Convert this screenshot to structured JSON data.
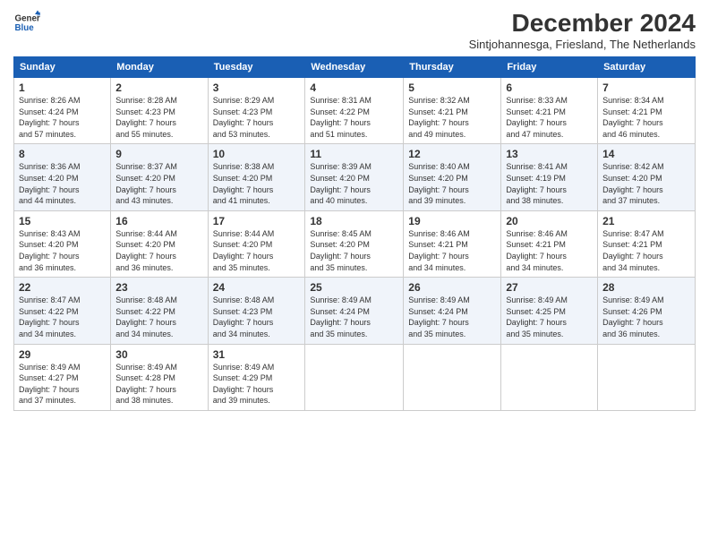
{
  "logo": {
    "line1": "General",
    "line2": "Blue"
  },
  "title": "December 2024",
  "subtitle": "Sintjohannesga, Friesland, The Netherlands",
  "days_of_week": [
    "Sunday",
    "Monday",
    "Tuesday",
    "Wednesday",
    "Thursday",
    "Friday",
    "Saturday"
  ],
  "weeks": [
    [
      {
        "day": "1",
        "sunrise": "8:26 AM",
        "sunset": "4:24 PM",
        "daylight": "7 hours and 57 minutes."
      },
      {
        "day": "2",
        "sunrise": "8:28 AM",
        "sunset": "4:23 PM",
        "daylight": "7 hours and 55 minutes."
      },
      {
        "day": "3",
        "sunrise": "8:29 AM",
        "sunset": "4:23 PM",
        "daylight": "7 hours and 53 minutes."
      },
      {
        "day": "4",
        "sunrise": "8:31 AM",
        "sunset": "4:22 PM",
        "daylight": "7 hours and 51 minutes."
      },
      {
        "day": "5",
        "sunrise": "8:32 AM",
        "sunset": "4:21 PM",
        "daylight": "7 hours and 49 minutes."
      },
      {
        "day": "6",
        "sunrise": "8:33 AM",
        "sunset": "4:21 PM",
        "daylight": "7 hours and 47 minutes."
      },
      {
        "day": "7",
        "sunrise": "8:34 AM",
        "sunset": "4:21 PM",
        "daylight": "7 hours and 46 minutes."
      }
    ],
    [
      {
        "day": "8",
        "sunrise": "8:36 AM",
        "sunset": "4:20 PM",
        "daylight": "7 hours and 44 minutes."
      },
      {
        "day": "9",
        "sunrise": "8:37 AM",
        "sunset": "4:20 PM",
        "daylight": "7 hours and 43 minutes."
      },
      {
        "day": "10",
        "sunrise": "8:38 AM",
        "sunset": "4:20 PM",
        "daylight": "7 hours and 41 minutes."
      },
      {
        "day": "11",
        "sunrise": "8:39 AM",
        "sunset": "4:20 PM",
        "daylight": "7 hours and 40 minutes."
      },
      {
        "day": "12",
        "sunrise": "8:40 AM",
        "sunset": "4:20 PM",
        "daylight": "7 hours and 39 minutes."
      },
      {
        "day": "13",
        "sunrise": "8:41 AM",
        "sunset": "4:19 PM",
        "daylight": "7 hours and 38 minutes."
      },
      {
        "day": "14",
        "sunrise": "8:42 AM",
        "sunset": "4:20 PM",
        "daylight": "7 hours and 37 minutes."
      }
    ],
    [
      {
        "day": "15",
        "sunrise": "8:43 AM",
        "sunset": "4:20 PM",
        "daylight": "7 hours and 36 minutes."
      },
      {
        "day": "16",
        "sunrise": "8:44 AM",
        "sunset": "4:20 PM",
        "daylight": "7 hours and 36 minutes."
      },
      {
        "day": "17",
        "sunrise": "8:44 AM",
        "sunset": "4:20 PM",
        "daylight": "7 hours and 35 minutes."
      },
      {
        "day": "18",
        "sunrise": "8:45 AM",
        "sunset": "4:20 PM",
        "daylight": "7 hours and 35 minutes."
      },
      {
        "day": "19",
        "sunrise": "8:46 AM",
        "sunset": "4:21 PM",
        "daylight": "7 hours and 34 minutes."
      },
      {
        "day": "20",
        "sunrise": "8:46 AM",
        "sunset": "4:21 PM",
        "daylight": "7 hours and 34 minutes."
      },
      {
        "day": "21",
        "sunrise": "8:47 AM",
        "sunset": "4:21 PM",
        "daylight": "7 hours and 34 minutes."
      }
    ],
    [
      {
        "day": "22",
        "sunrise": "8:47 AM",
        "sunset": "4:22 PM",
        "daylight": "7 hours and 34 minutes."
      },
      {
        "day": "23",
        "sunrise": "8:48 AM",
        "sunset": "4:22 PM",
        "daylight": "7 hours and 34 minutes."
      },
      {
        "day": "24",
        "sunrise": "8:48 AM",
        "sunset": "4:23 PM",
        "daylight": "7 hours and 34 minutes."
      },
      {
        "day": "25",
        "sunrise": "8:49 AM",
        "sunset": "4:24 PM",
        "daylight": "7 hours and 35 minutes."
      },
      {
        "day": "26",
        "sunrise": "8:49 AM",
        "sunset": "4:24 PM",
        "daylight": "7 hours and 35 minutes."
      },
      {
        "day": "27",
        "sunrise": "8:49 AM",
        "sunset": "4:25 PM",
        "daylight": "7 hours and 35 minutes."
      },
      {
        "day": "28",
        "sunrise": "8:49 AM",
        "sunset": "4:26 PM",
        "daylight": "7 hours and 36 minutes."
      }
    ],
    [
      {
        "day": "29",
        "sunrise": "8:49 AM",
        "sunset": "4:27 PM",
        "daylight": "7 hours and 37 minutes."
      },
      {
        "day": "30",
        "sunrise": "8:49 AM",
        "sunset": "4:28 PM",
        "daylight": "7 hours and 38 minutes."
      },
      {
        "day": "31",
        "sunrise": "8:49 AM",
        "sunset": "4:29 PM",
        "daylight": "7 hours and 39 minutes."
      },
      null,
      null,
      null,
      null
    ]
  ]
}
